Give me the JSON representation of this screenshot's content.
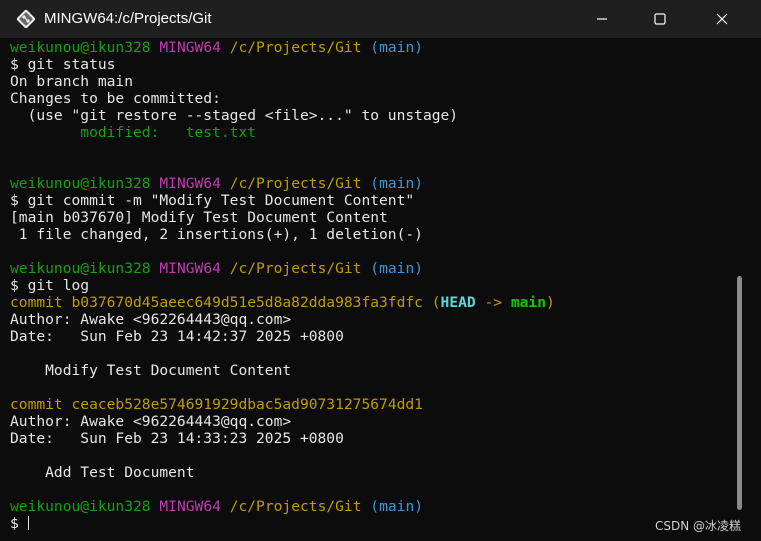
{
  "window": {
    "title": "MINGW64:/c/Projects/Git",
    "minimize_label": "",
    "maximize_label": "",
    "close_label": ""
  },
  "terminal": {
    "prompt1": {
      "user": "weikunou@ikun328",
      "system": "MINGW64",
      "path": "/c/Projects/Git",
      "branch": "(main)"
    },
    "cmd1": "$ git status",
    "out1": [
      "On branch main",
      "Changes to be committed:",
      "  (use \"git restore --staged <file>...\" to unstage)"
    ],
    "modified_line": "        modified:   test.txt",
    "prompt2": {
      "user": "weikunou@ikun328",
      "system": "MINGW64",
      "path": "/c/Projects/Git",
      "branch": "(main)"
    },
    "cmd2": "$ git commit -m \"Modify Test Document Content\"",
    "out2": [
      "[main b037670] Modify Test Document Content",
      " 1 file changed, 2 insertions(+), 1 deletion(-)"
    ],
    "prompt3": {
      "user": "weikunou@ikun328",
      "system": "MINGW64",
      "path": "/c/Projects/Git",
      "branch": "(main)"
    },
    "cmd3": "$ git log",
    "commit1": {
      "hash_line": "commit b037670d45aeec649d51e5d8a82dda983fa3fdfc",
      "ref_open": "(",
      "head": "HEAD",
      "arrow": " -> ",
      "branch": "main",
      "ref_close": ")",
      "author": "Author: Awake <962264443@qq.com>",
      "date": "Date:   Sun Feb 23 14:42:37 2025 +0800",
      "message": "    Modify Test Document Content"
    },
    "commit2": {
      "hash_line": "commit ceaceb528e574691929dbac5ad90731275674dd1",
      "author": "Author: Awake <962264443@qq.com>",
      "date": "Date:   Sun Feb 23 14:33:23 2025 +0800",
      "message": "    Add Test Document"
    },
    "prompt4": {
      "user": "weikunou@ikun328",
      "system": "MINGW64",
      "path": "/c/Projects/Git",
      "branch": "(main)"
    },
    "current_input": "$ "
  },
  "watermark": "CSDN @冰凌糕",
  "colors": {
    "background": "#0c0c0c",
    "titlebar": "#1f1f1f",
    "prompt_user": "#13a10e",
    "prompt_system": "#c239b3",
    "prompt_path": "#c19c00",
    "prompt_branch": "#3a96dd"
  },
  "icons": [
    "git-bash-icon",
    "minimize-icon",
    "maximize-icon",
    "close-icon"
  ]
}
